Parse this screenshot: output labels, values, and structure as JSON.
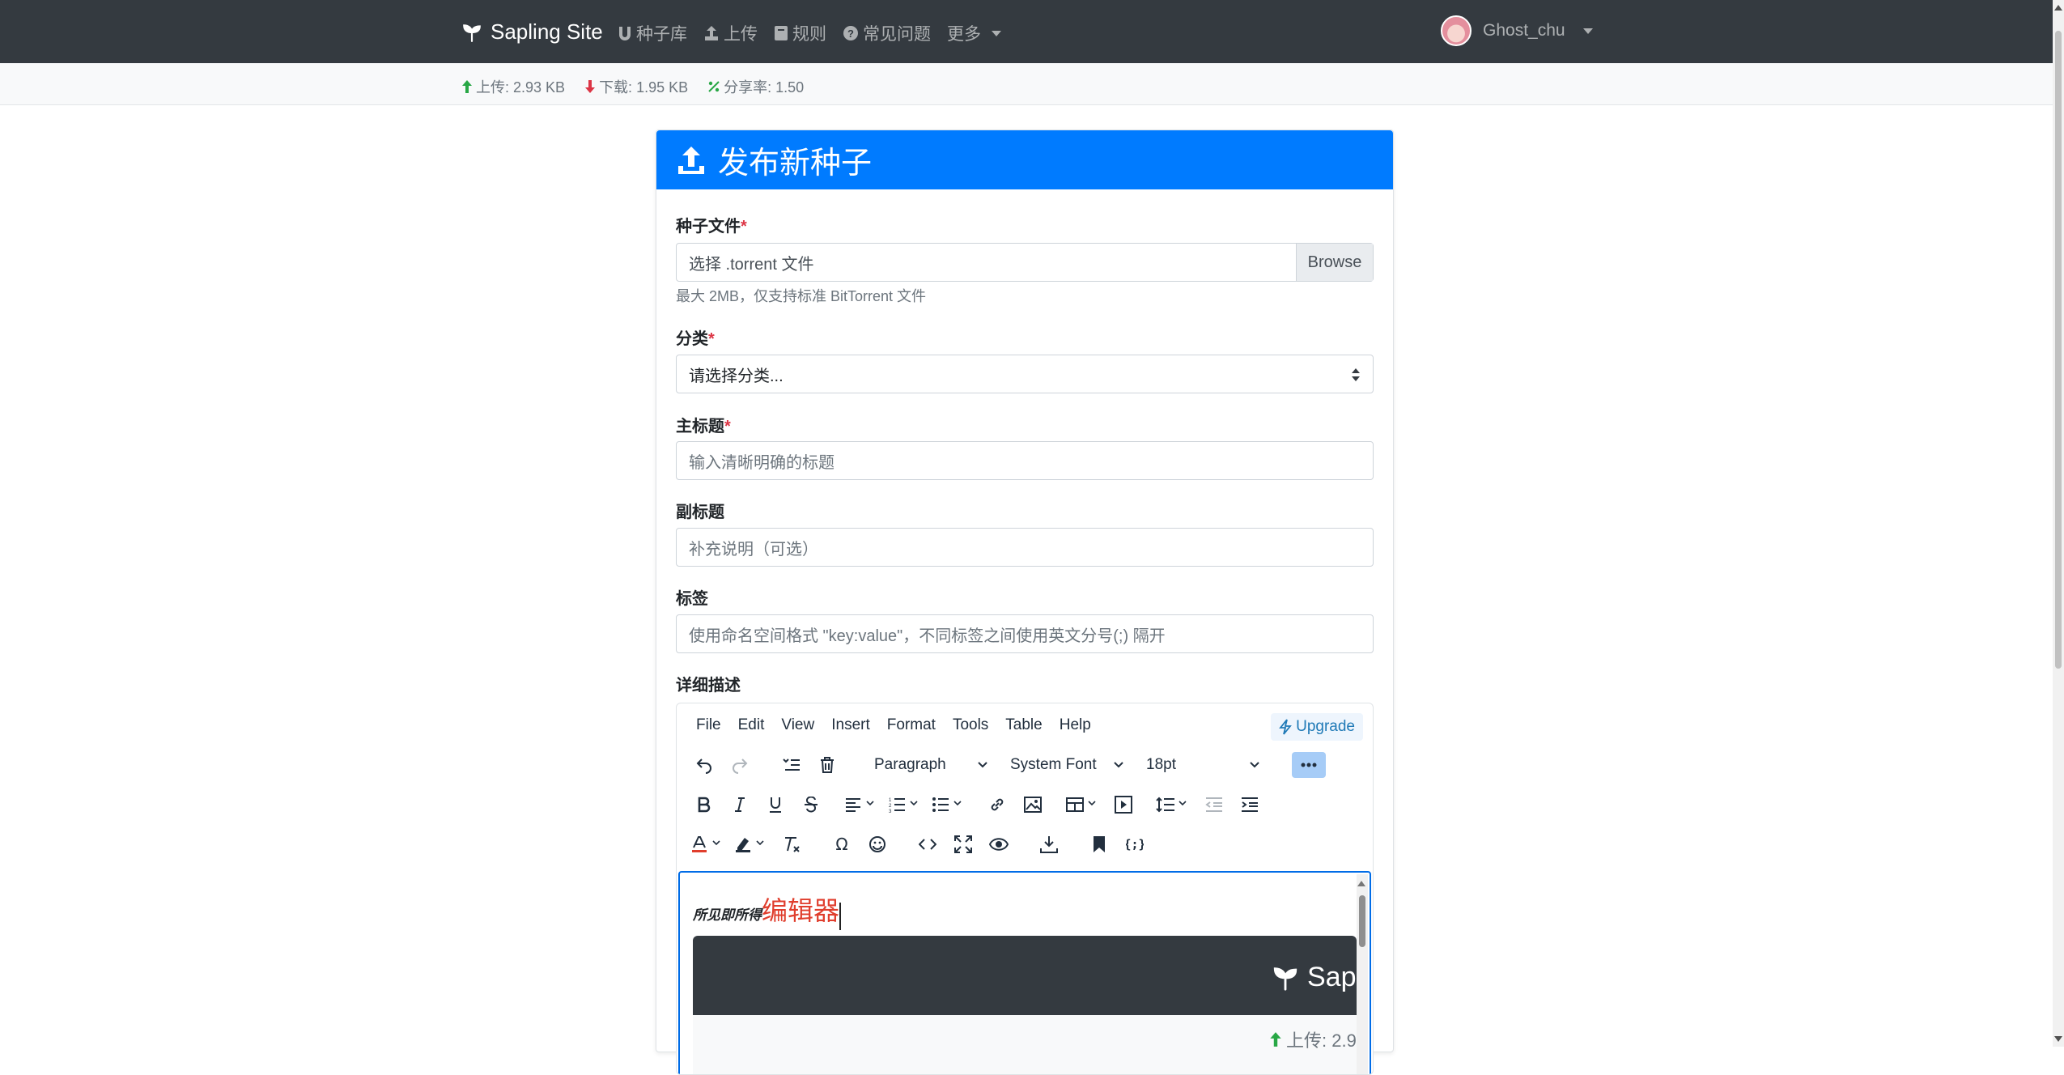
{
  "nav": {
    "brand": "Sapling Site",
    "links": [
      {
        "label": "种子库",
        "icon": "magnet-icon"
      },
      {
        "label": "上传",
        "icon": "upload-icon"
      },
      {
        "label": "规则",
        "icon": "book-icon"
      },
      {
        "label": "常见问题",
        "icon": "question-circle-icon"
      }
    ],
    "more_label": "更多",
    "username": "Ghost_chu"
  },
  "stats": {
    "upload": "上传: 2.93 KB",
    "download": "下载: 1.95 KB",
    "ratio": "分享率: 1.50",
    "colors": {
      "upload": "#28a745",
      "download": "#dc3545",
      "ratio": "#28a745"
    }
  },
  "card": {
    "title": "发布新种子",
    "header_color": "#007bff"
  },
  "form": {
    "torrent": {
      "label": "种子文件",
      "required_mark": "*",
      "file_label": "选择 .torrent 文件",
      "browse_label": "Browse",
      "help": "最大 2MB，仅支持标准 BitTorrent 文件"
    },
    "category": {
      "label": "分类",
      "required_mark": "*",
      "selected": "请选择分类..."
    },
    "title": {
      "label": "主标题",
      "required_mark": "*",
      "placeholder": "输入清晰明确的标题"
    },
    "subtitle": {
      "label": "副标题",
      "placeholder": "补充说明（可选）"
    },
    "tags": {
      "label": "标签",
      "placeholder": "使用命名空间格式 \"key:value\"，不同标签之间使用英文分号(;) 隔开"
    },
    "description": {
      "label": "详细描述"
    }
  },
  "editor": {
    "menu": [
      "File",
      "Edit",
      "View",
      "Insert",
      "Format",
      "Tools",
      "Table",
      "Help"
    ],
    "upgrade_label": "Upgrade",
    "block_format": "Paragraph",
    "font_family": "System Font",
    "font_size": "18pt",
    "content": {
      "prefix": "所见即所得",
      "highlight": "编辑器"
    },
    "preview": {
      "brand": "Sapl",
      "stat": "上传: 2.9"
    }
  }
}
